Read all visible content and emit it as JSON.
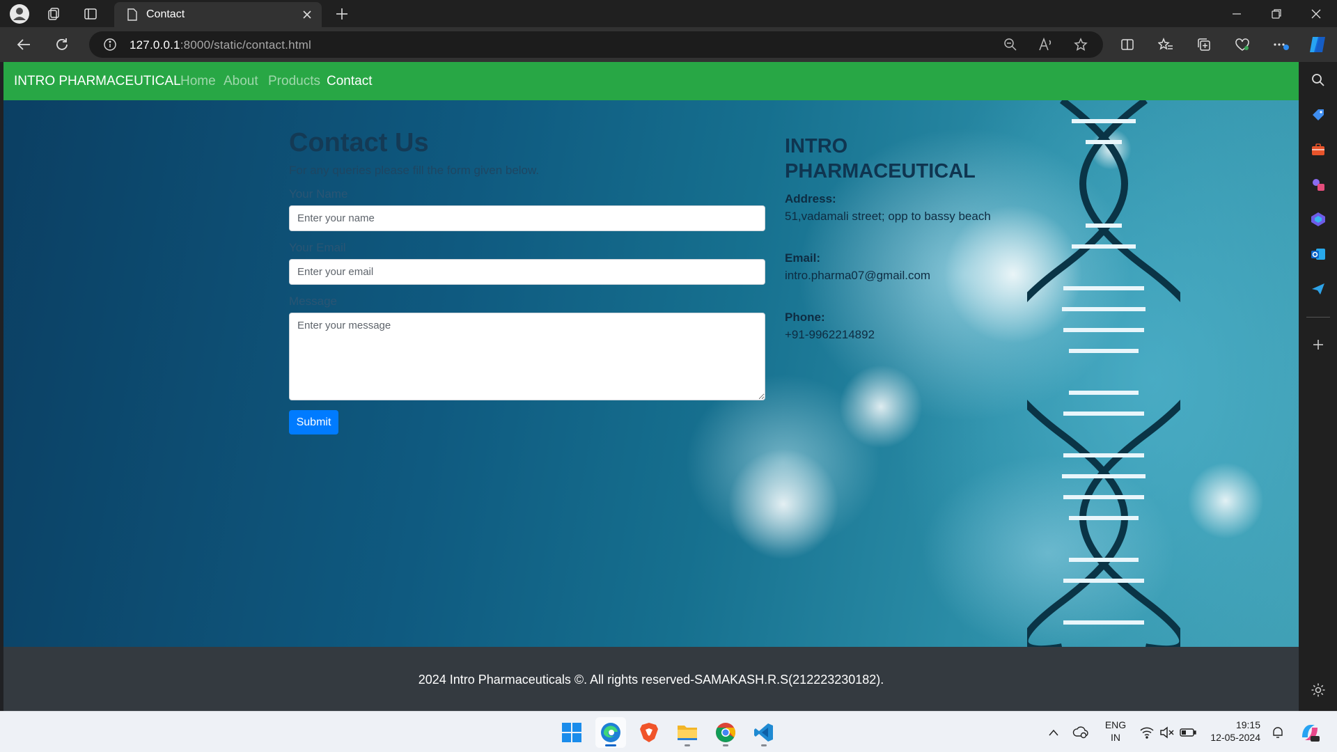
{
  "browser": {
    "tab_title": "Contact",
    "url_host": "127.0.0.1",
    "url_path": ":8000/static/contact.html"
  },
  "navbar": {
    "brand": "INTRO PHARMACEUTICAL",
    "links": [
      "Home",
      "About",
      "Products",
      "Contact"
    ],
    "active": "Contact"
  },
  "contact_form": {
    "heading": "Contact Us",
    "lead": "For any queries please fill the form given below.",
    "name_label": "Your Name",
    "name_placeholder": "Enter your name",
    "email_label": "Your Email",
    "email_placeholder": "Enter your email",
    "message_label": "Message",
    "message_placeholder": "Enter your message",
    "submit_label": "Submit"
  },
  "company_info": {
    "title": "INTRO PHARMACEUTICAL",
    "address_label": "Address:",
    "address": "51,vadamali street; opp to bassy beach",
    "email_label": "Email:",
    "email": "intro.pharma07@gmail.com",
    "phone_label": "Phone:",
    "phone": "+91-9962214892"
  },
  "footer": {
    "text": "2024 Intro Pharmaceuticals ©. All rights reserved-SAMAKASH.R.S(212223230182)."
  },
  "taskbar": {
    "lang_line1": "ENG",
    "lang_line2": "IN",
    "time": "19:15",
    "date": "12-05-2024"
  },
  "colors": {
    "navbar": "#28a745",
    "submit": "#007bff",
    "footer": "#343a40"
  }
}
